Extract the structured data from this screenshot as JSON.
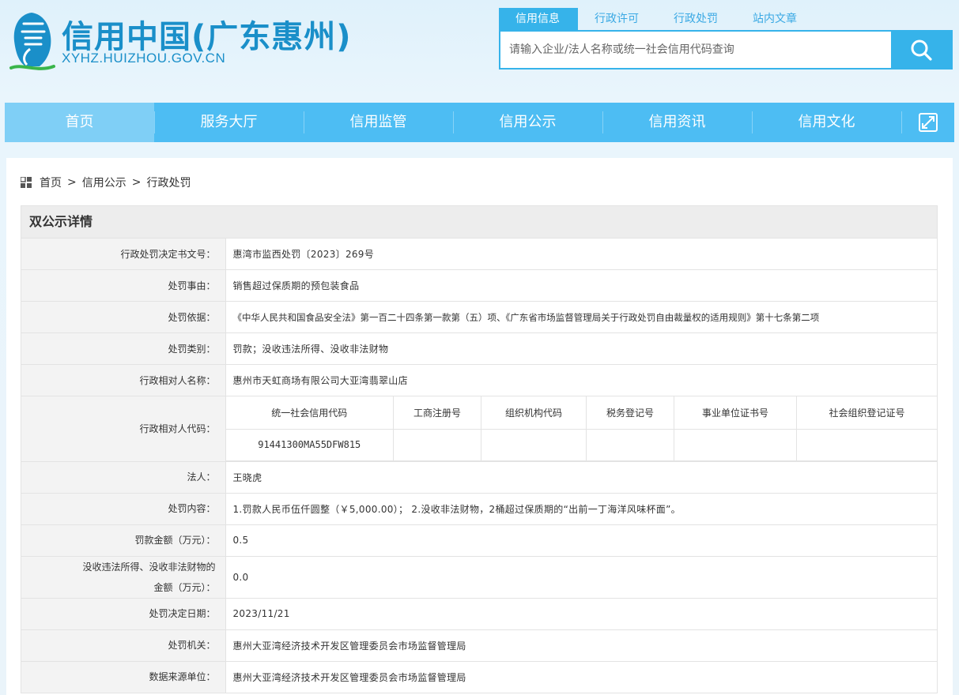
{
  "header": {
    "site_name": "信用中国(广东惠州)",
    "site_url": "XYHZ.HUIZHOU.GOV.CN",
    "logo_icon": "credit-china-logo-icon",
    "brand_color": "#1a8fc9",
    "accent_color": "#36b3ea"
  },
  "search": {
    "tabs": [
      {
        "label": "信用信息",
        "active": true
      },
      {
        "label": "行政许可",
        "active": false
      },
      {
        "label": "行政处罚",
        "active": false
      },
      {
        "label": "站内文章",
        "active": false
      }
    ],
    "placeholder": "请输入企业/法人名称或统一社会信用代码查询",
    "value": "",
    "button_icon": "search-icon"
  },
  "nav": {
    "items": [
      {
        "label": "首页",
        "active": true
      },
      {
        "label": "服务大厅",
        "active": false
      },
      {
        "label": "信用监管",
        "active": false
      },
      {
        "label": "信用公示",
        "active": false
      },
      {
        "label": "信用资讯",
        "active": false
      },
      {
        "label": "信用文化",
        "active": false
      }
    ],
    "expand_icon": "expand-icon"
  },
  "breadcrumb": {
    "icon": "grid-icon",
    "items": [
      "首页",
      "信用公示",
      "行政处罚"
    ],
    "separator": ">"
  },
  "detail": {
    "title": "双公示详情",
    "rows": {
      "decision_no": {
        "label": "行政处罚决定书文号：",
        "value": "惠湾市监西处罚〔2023〕269号"
      },
      "reason": {
        "label": "处罚事由：",
        "value": "销售超过保质期的预包装食品"
      },
      "basis": {
        "label": "处罚依据：",
        "value": "《中华人民共和国食品安全法》第一百二十四条第一款第（五）项、《广东省市场监督管理局关于行政处罚自由裁量权的适用规则》第十七条第二项"
      },
      "category": {
        "label": "处罚类别：",
        "value": "罚款；没收违法所得、没收非法财物"
      },
      "party_name": {
        "label": "行政相对人名称：",
        "value": "惠州市天虹商场有限公司大亚湾翡翠山店"
      },
      "party_code": {
        "label": "行政相对人代码：",
        "headers": [
          "统一社会信用代码",
          "工商注册号",
          "组织机构代码",
          "税务登记号",
          "事业单位证书号",
          "社会组织登记证号"
        ],
        "values": [
          "91441300MA55DFW815",
          "",
          "",
          "",
          "",
          ""
        ]
      },
      "legal_person": {
        "label": "法人：",
        "value": "王晓虎"
      },
      "content": {
        "label": "处罚内容：",
        "value": "1.罚款人民币伍仟圆整（￥5,000.00）； 2.没收非法财物，2桶超过保质期的“出前一丁海洋风味杯面”。"
      },
      "fine": {
        "label": "罚款金额（万元）：",
        "value": "0.5"
      },
      "confiscation": {
        "label_line1": "没收违法所得、没收非法财物的",
        "label_line2": "金额（万元）：",
        "value": "0.0"
      },
      "date": {
        "label": "处罚决定日期：",
        "value": "2023/11/21"
      },
      "authority": {
        "label": "处罚机关：",
        "value": "惠州大亚湾经济技术开发区管理委员会市场监督管理局"
      },
      "source": {
        "label": "数据来源单位：",
        "value": "惠州大亚湾经济技术开发区管理委员会市场监督管理局"
      }
    }
  }
}
